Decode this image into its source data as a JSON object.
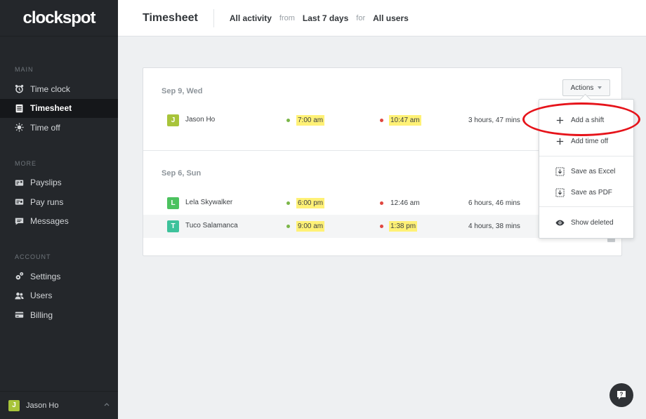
{
  "app": {
    "logo": "clockspot"
  },
  "sidebar": {
    "sections": [
      {
        "heading": "MAIN",
        "items": [
          {
            "label": "Time clock",
            "icon": "alarm-clock-icon"
          },
          {
            "label": "Timesheet",
            "icon": "timesheet-icon",
            "active": true
          },
          {
            "label": "Time off",
            "icon": "sun-icon"
          }
        ]
      },
      {
        "heading": "MORE",
        "items": [
          {
            "label": "Payslips",
            "icon": "payslip-icon"
          },
          {
            "label": "Pay runs",
            "icon": "payrun-icon"
          },
          {
            "label": "Messages",
            "icon": "message-icon"
          }
        ]
      },
      {
        "heading": "ACCOUNT",
        "items": [
          {
            "label": "Settings",
            "icon": "gear-icon"
          },
          {
            "label": "Users",
            "icon": "users-icon"
          },
          {
            "label": "Billing",
            "icon": "credit-card-icon"
          }
        ]
      }
    ],
    "user": {
      "initial": "J",
      "name": "Jason Ho",
      "color": "#a8c43a"
    }
  },
  "header": {
    "title": "Timesheet",
    "filter_activity": "All activity",
    "from_label": "from",
    "filter_range": "Last 7 days",
    "for_label": "for",
    "filter_users": "All users"
  },
  "timesheet": {
    "actions_label": "Actions",
    "days": [
      {
        "label": "Sep 9, Wed",
        "entries": [
          {
            "initial": "J",
            "name": "Jason Ho",
            "color": "#a8c43a",
            "time_in": "7:00 am",
            "time_out": "10:47 am",
            "duration": "3 hours, 47 mins"
          }
        ]
      },
      {
        "label": "Sep 6, Sun",
        "entries": [
          {
            "initial": "L",
            "name": "Lela Skywalker",
            "color": "#4cc25f",
            "time_in": "6:00 pm",
            "time_out": "12:46 am",
            "duration": "6 hours, 46 mins"
          },
          {
            "initial": "T",
            "name": "Tuco Salamanca",
            "color": "#3dc29b",
            "time_in": "9:00 am",
            "time_out": "1:38 pm",
            "duration": "4 hours, 38 mins"
          }
        ]
      }
    ]
  },
  "actions_menu": {
    "add_shift": "Add a shift",
    "add_time_off": "Add time off",
    "save_excel": "Save as Excel",
    "save_pdf": "Save as PDF",
    "show_deleted": "Show deleted"
  },
  "colors": {
    "highlight": "#fff176",
    "annotation": "#e6131a",
    "sidebar_bg": "#24272b"
  }
}
